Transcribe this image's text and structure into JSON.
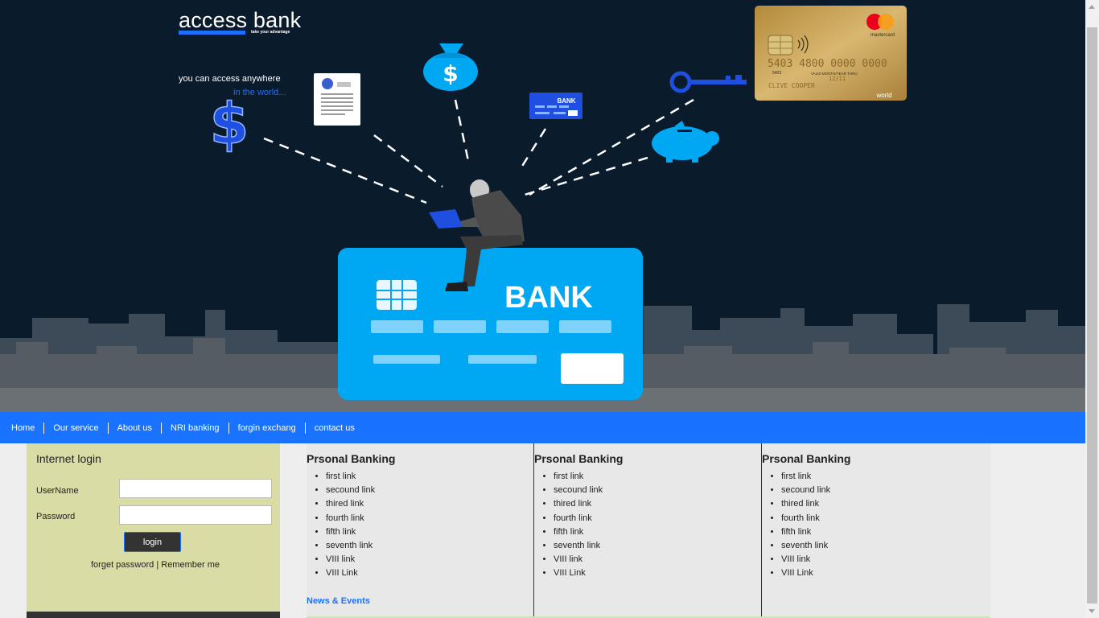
{
  "brand": {
    "name": "access bank",
    "tagline": "take your advantage"
  },
  "hero": {
    "line1": "you can access anywhere",
    "line2": "in the world...",
    "big_card_label": "BANK",
    "small_card_label": "BANK",
    "mastercard": {
      "brand": "mastercard",
      "number": "5403 4800 0000 0000",
      "small_code": "5403",
      "valid_label": "VALID MONTH/YEAR THRU",
      "expiry": "12/11",
      "holder": "CLIVE COOPER",
      "tier": "world"
    },
    "colors": {
      "background": "#0a1b2b",
      "accent_blue": "#00a8f3",
      "card_blue": "#1f4fe0",
      "gold": "#c8a24a"
    }
  },
  "nav": {
    "items": [
      "Home",
      "Our service",
      "About us",
      "NRI banking",
      "forgin exchang",
      "contact us"
    ],
    "background": "#1a73ff"
  },
  "login": {
    "title": "Internet login",
    "username_label": "UserName",
    "password_label": "Password",
    "username_value": "",
    "password_value": "",
    "button_label": "login",
    "forget_password": "forget password",
    "separator": "|",
    "remember_me": "Remember me",
    "background": "#dadca5"
  },
  "columns": [
    {
      "title": "Prsonal Banking",
      "links": [
        "first link",
        "secound link",
        "thired link",
        "fourth link",
        "fifth link",
        "seventh link",
        "VIII link",
        "VIII Link"
      ],
      "footer_link": "News & Events"
    },
    {
      "title": "Prsonal Banking",
      "links": [
        "first link",
        "secound link",
        "thired link",
        "fourth link",
        "fifth link",
        "seventh link",
        "VIII link",
        "VIII Link"
      ]
    },
    {
      "title": "Prsonal Banking",
      "links": [
        "first link",
        "secound link",
        "thired link",
        "fourth link",
        "fifth link",
        "seventh link",
        "VIII link",
        "VIII Link"
      ]
    }
  ]
}
